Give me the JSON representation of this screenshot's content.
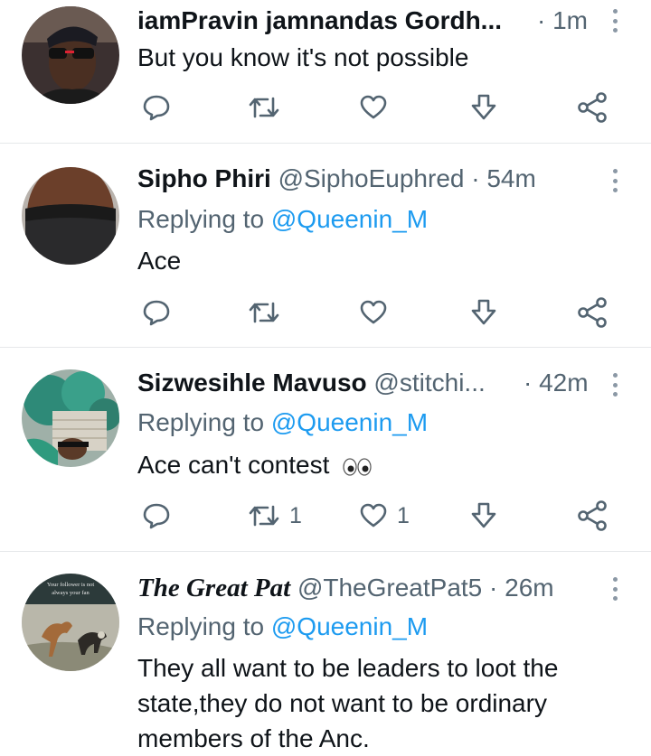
{
  "tweets": [
    {
      "name": "iamPravin jamnandas Gordh...",
      "handle": "",
      "time": "· 1m",
      "replying_prefix": "",
      "replying_to": "",
      "text": "But you know it's not possible",
      "retweets": "",
      "likes": ""
    },
    {
      "name": "Sipho Phiri",
      "handle": "@SiphoEuphred",
      "time": "· 54m",
      "replying_prefix": "Replying to",
      "replying_to": "@Queenin_M",
      "text": "Ace",
      "retweets": "",
      "likes": ""
    },
    {
      "name": "Sizwesihle Mavuso",
      "handle": "@stitchi...",
      "time": "· 42m",
      "replying_prefix": "Replying to",
      "replying_to": "@Queenin_M",
      "text": "Ace can't contest",
      "retweets": "1",
      "likes": "1"
    },
    {
      "name": "The Great Pat",
      "handle": "@TheGreatPat5",
      "time": "· 26m",
      "replying_prefix": "Replying to",
      "replying_to": "@Queenin_M",
      "text_lines": [
        "They all want to be leaders to loot the",
        "state,they do not want to be ordinary",
        "members of the Anc."
      ],
      "retweets": "",
      "likes": "",
      "avatar_caption_1": "Your follower is not",
      "avatar_caption_2": "always your fan"
    }
  ],
  "icons": {
    "reply": "reply-icon",
    "retweet": "retweet-icon",
    "like": "heart-icon",
    "share": "share-icon",
    "download": "download-icon",
    "more": "more-icon"
  },
  "colors": {
    "mention": "#1d9bf0",
    "secondary_text": "#536471",
    "primary_text": "#0f1419",
    "divider": "#e6e8ea"
  }
}
